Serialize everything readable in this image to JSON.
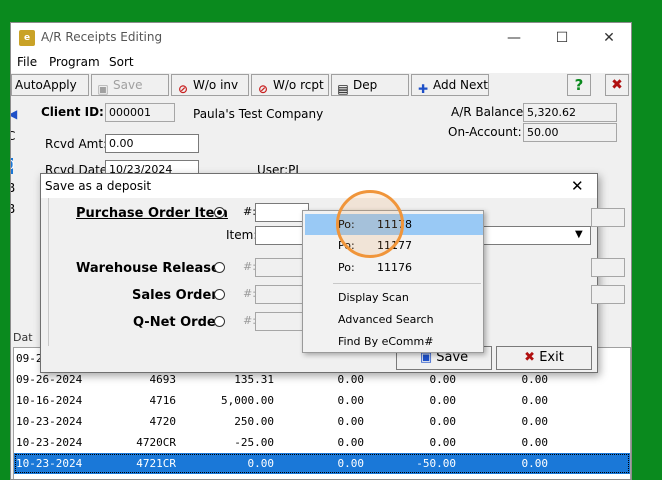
{
  "window": {
    "title": "A/R Receipts Editing",
    "icon_text": "e"
  },
  "menu": [
    "File",
    "Program",
    "Sort"
  ],
  "toolbar": {
    "autoapply": "AutoApply",
    "save": "Save",
    "wo_inv": "W/o inv",
    "wo_rcpt": "W/o rcpt",
    "dep": "Dep",
    "add_next": "Add Next",
    "help_glyph": "?",
    "close_glyph": "✖"
  },
  "header": {
    "client_id_label": "Client ID:",
    "client_id": "000001",
    "client_name": "Paula's Test Company",
    "ar_balance_label": "A/R Balance:",
    "ar_balance": "5,320.62",
    "on_account_label": "On-Account:",
    "on_account": "50.00",
    "rcvd_amt_label": "Rcvd Amt:",
    "rcvd_amt": "0.00",
    "rcvd_date_label": "Rcvd Date:",
    "rcvd_date": "10/23/2024",
    "user_label": "User:PL"
  },
  "behind_fragments": [
    "C",
    "0",
    "B",
    "B"
  ],
  "grid": {
    "head_fragment": "Dat",
    "rows": [
      {
        "date": "09-2",
        "num": "",
        "amt": "",
        "a": "",
        "b": "",
        "c": ""
      },
      {
        "date": "09-26-2024",
        "num": "4693",
        "amt": "135.31",
        "a": "0.00",
        "b": "0.00",
        "c": "0.00"
      },
      {
        "date": "10-16-2024",
        "num": "4716",
        "amt": "5,000.00",
        "a": "0.00",
        "b": "0.00",
        "c": "0.00"
      },
      {
        "date": "10-23-2024",
        "num": "4720",
        "amt": "250.00",
        "a": "0.00",
        "b": "0.00",
        "c": "0.00"
      },
      {
        "date": "10-23-2024",
        "num": "4720CR",
        "amt": "-25.00",
        "a": "0.00",
        "b": "0.00",
        "c": "0.00"
      },
      {
        "date": "10-23-2024",
        "num": "4721CR",
        "amt": "0.00",
        "a": "0.00",
        "b": "-50.00",
        "c": "0.00"
      }
    ]
  },
  "dialog": {
    "title": "Save as a deposit",
    "close_glyph": "✕",
    "purchase_order_item": "Purchase Order Item",
    "po_num_label": "#:",
    "item_label": "Item:",
    "warehouse_release": "Warehouse Release",
    "wr_num_label": "#:",
    "sales_order": "Sales Order",
    "so_num_label": "#:",
    "qnet_order": "Q-Net Order",
    "qn_num_label": "#:",
    "save": "Save",
    "exit": "Exit"
  },
  "popup": {
    "items": [
      {
        "prefix": "Po:",
        "value": "11178"
      },
      {
        "prefix": "Po:",
        "value": "11177"
      },
      {
        "prefix": "Po:",
        "value": "11176"
      }
    ],
    "display_scan": "Display Scan",
    "advanced_search": "Advanced Search",
    "find_by_ecomm": "Find By eComm#"
  },
  "colors": {
    "desktop": "#0a8a1e",
    "selection": "#1a78d8",
    "popup_highlight": "#99c9f5",
    "cursor_ring": "#f0953a"
  }
}
